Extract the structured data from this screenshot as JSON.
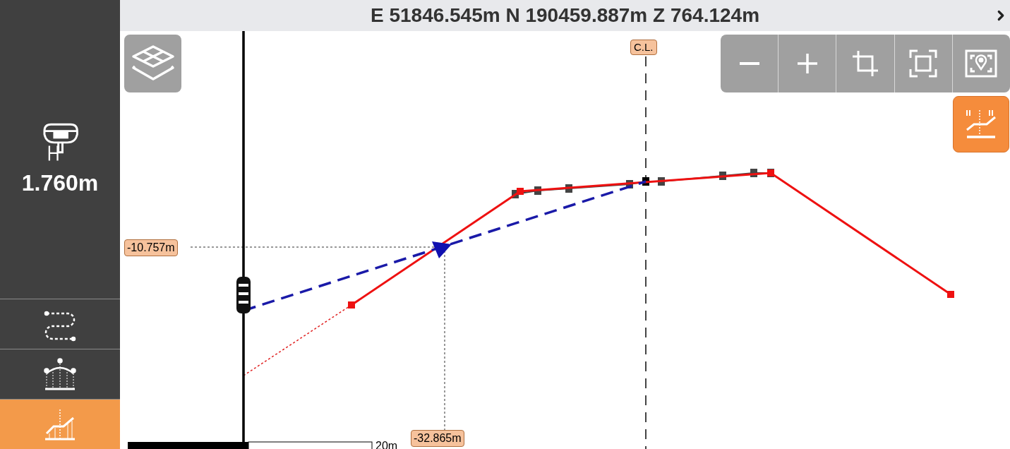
{
  "top_bar": {
    "coordinates": "E 51846.545m N 190459.887m Z 764.124m"
  },
  "sidebar": {
    "antenna_height": "1.760m",
    "nav_items": [
      {
        "kind": "alignment",
        "selected": false
      },
      {
        "kind": "cross-section",
        "selected": false
      },
      {
        "kind": "profile",
        "selected": true
      }
    ]
  },
  "canvas": {
    "centerline_label": "C.L.",
    "elevation_label": "-10.757m",
    "offset_label": "-32.865m",
    "scale_label": "20m"
  },
  "profile_button": {
    "on": true
  }
}
